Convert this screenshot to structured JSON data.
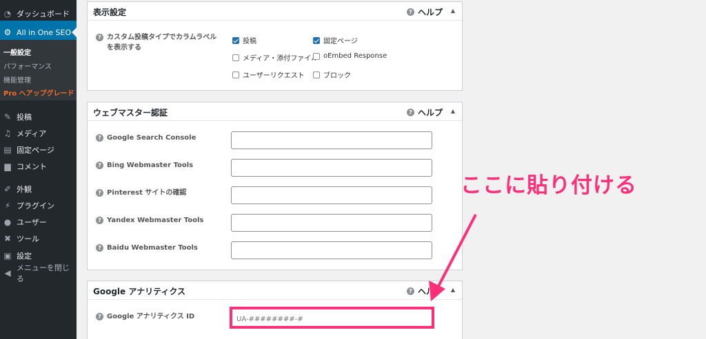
{
  "sidebar": {
    "dashboard": "ダッシュボード",
    "aioseo": "All in One SEO",
    "submenu": [
      "一般設定",
      "パフォーマンス",
      "機能管理",
      "Pro へアップグレード"
    ],
    "items": [
      "投稿",
      "メディア",
      "固定ページ",
      "コメント",
      "外観",
      "プラグイン",
      "ユーザー",
      "ツール",
      "設定",
      "メニューを閉じる"
    ]
  },
  "panels": {
    "display": {
      "title": "表示設定",
      "help": "ヘルプ",
      "label_line1": "カスタム投稿タイプでカラムラベル",
      "label_line2": "を表示する",
      "options": [
        {
          "label": "投稿",
          "checked": true
        },
        {
          "label": "固定ページ",
          "checked": true
        },
        {
          "label": "メディア・添付ファイル",
          "checked": false
        },
        {
          "label": "oEmbed Response",
          "checked": false
        },
        {
          "label": "ユーザーリクエスト",
          "checked": false
        },
        {
          "label": "ブロック",
          "checked": false
        }
      ]
    },
    "webmaster": {
      "title": "ウェブマスター認証",
      "help": "ヘルプ",
      "rows": [
        "Google Search Console",
        "Bing Webmaster Tools",
        "Pinterest サイトの確認",
        "Yandex Webmaster Tools",
        "Baidu Webmaster Tools"
      ]
    },
    "analytics": {
      "title": "Google アナリティクス",
      "help": "ヘルプ",
      "id_label": "Google アナリティクス ID",
      "id_placeholder": "UA-########-#"
    }
  },
  "annotation": "ここに貼り付ける",
  "colors": {
    "accent": "#0073aa",
    "annotation": "#fd2f7b",
    "sidebar": "#23282d"
  }
}
